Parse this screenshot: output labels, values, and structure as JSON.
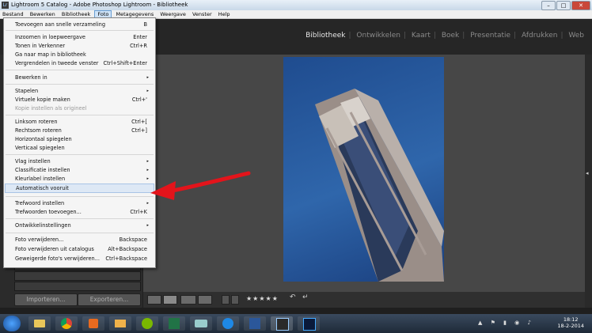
{
  "window": {
    "title": "Lightroom 5 Catalog - Adobe Photoshop Lightroom - Bibliotheek",
    "app_icon": "Lr",
    "minimize": "–",
    "maximize": "□",
    "close": "✕"
  },
  "menubar": [
    "Bestand",
    "Bewerken",
    "Bibliotheek",
    "Foto",
    "Metagegevens",
    "Weergave",
    "Venster",
    "Help"
  ],
  "modules": [
    "Bibliotheek",
    "Ontwikkelen",
    "Kaart",
    "Boek",
    "Presentatie",
    "Afdrukken",
    "Web"
  ],
  "module_separator": "|",
  "dropdown": {
    "items": [
      {
        "label": "Toevoegen aan snelle verzameling",
        "shortcut": "B"
      },
      {
        "label": "Inzoomen in loepweergave",
        "shortcut": "Enter"
      },
      {
        "label": "Tonen in Verkenner",
        "shortcut": "Ctrl+R"
      },
      {
        "label": "Ga naar map in bibliotheek",
        "shortcut": ""
      },
      {
        "label": "Vergrendelen in tweede venster",
        "shortcut": "Ctrl+Shift+Enter"
      },
      {
        "label": "Bewerken in",
        "shortcut": ""
      },
      {
        "label": "Stapelen",
        "shortcut": ""
      },
      {
        "label": "Virtuele kopie maken",
        "shortcut": "Ctrl+'"
      },
      {
        "label": "Kopie instellen als origineel",
        "shortcut": ""
      },
      {
        "label": "Linksom roteren",
        "shortcut": "Ctrl+["
      },
      {
        "label": "Rechtsom roteren",
        "shortcut": "Ctrl+]"
      },
      {
        "label": "Horizontaal spiegelen",
        "shortcut": ""
      },
      {
        "label": "Verticaal spiegelen",
        "shortcut": ""
      },
      {
        "label": "Vlag instellen",
        "shortcut": ""
      },
      {
        "label": "Classificatie instellen",
        "shortcut": ""
      },
      {
        "label": "Kleurlabel instellen",
        "shortcut": ""
      },
      {
        "label": "Automatisch vooruit",
        "shortcut": ""
      },
      {
        "label": "Trefwoord instellen",
        "shortcut": ""
      },
      {
        "label": "Trefwoorden toevoegen...",
        "shortcut": "Ctrl+K"
      },
      {
        "label": "Ontwikkelinstellingen",
        "shortcut": ""
      },
      {
        "label": "Foto verwijderen...",
        "shortcut": "Backspace"
      },
      {
        "label": "Foto verwijderen uit catalogus",
        "shortcut": "Alt+Backspace"
      },
      {
        "label": "Geweigerde foto's verwijderen...",
        "shortcut": "Ctrl+Backspace"
      }
    ],
    "submenu_glyph": "▸",
    "check_glyph": "✓"
  },
  "left_panel": {
    "import_label": "Importeren...",
    "export_label": "Exporteren..."
  },
  "toolbar": {
    "stars": "★★★★★",
    "rotate_left": "↶",
    "rotate_right": "↵"
  },
  "right_edge_arrow": "◂",
  "clock": {
    "time": "18:12",
    "date": "18-2-2014"
  },
  "tray_icons": "▲ ⚑ ▮ ◉ ♪"
}
